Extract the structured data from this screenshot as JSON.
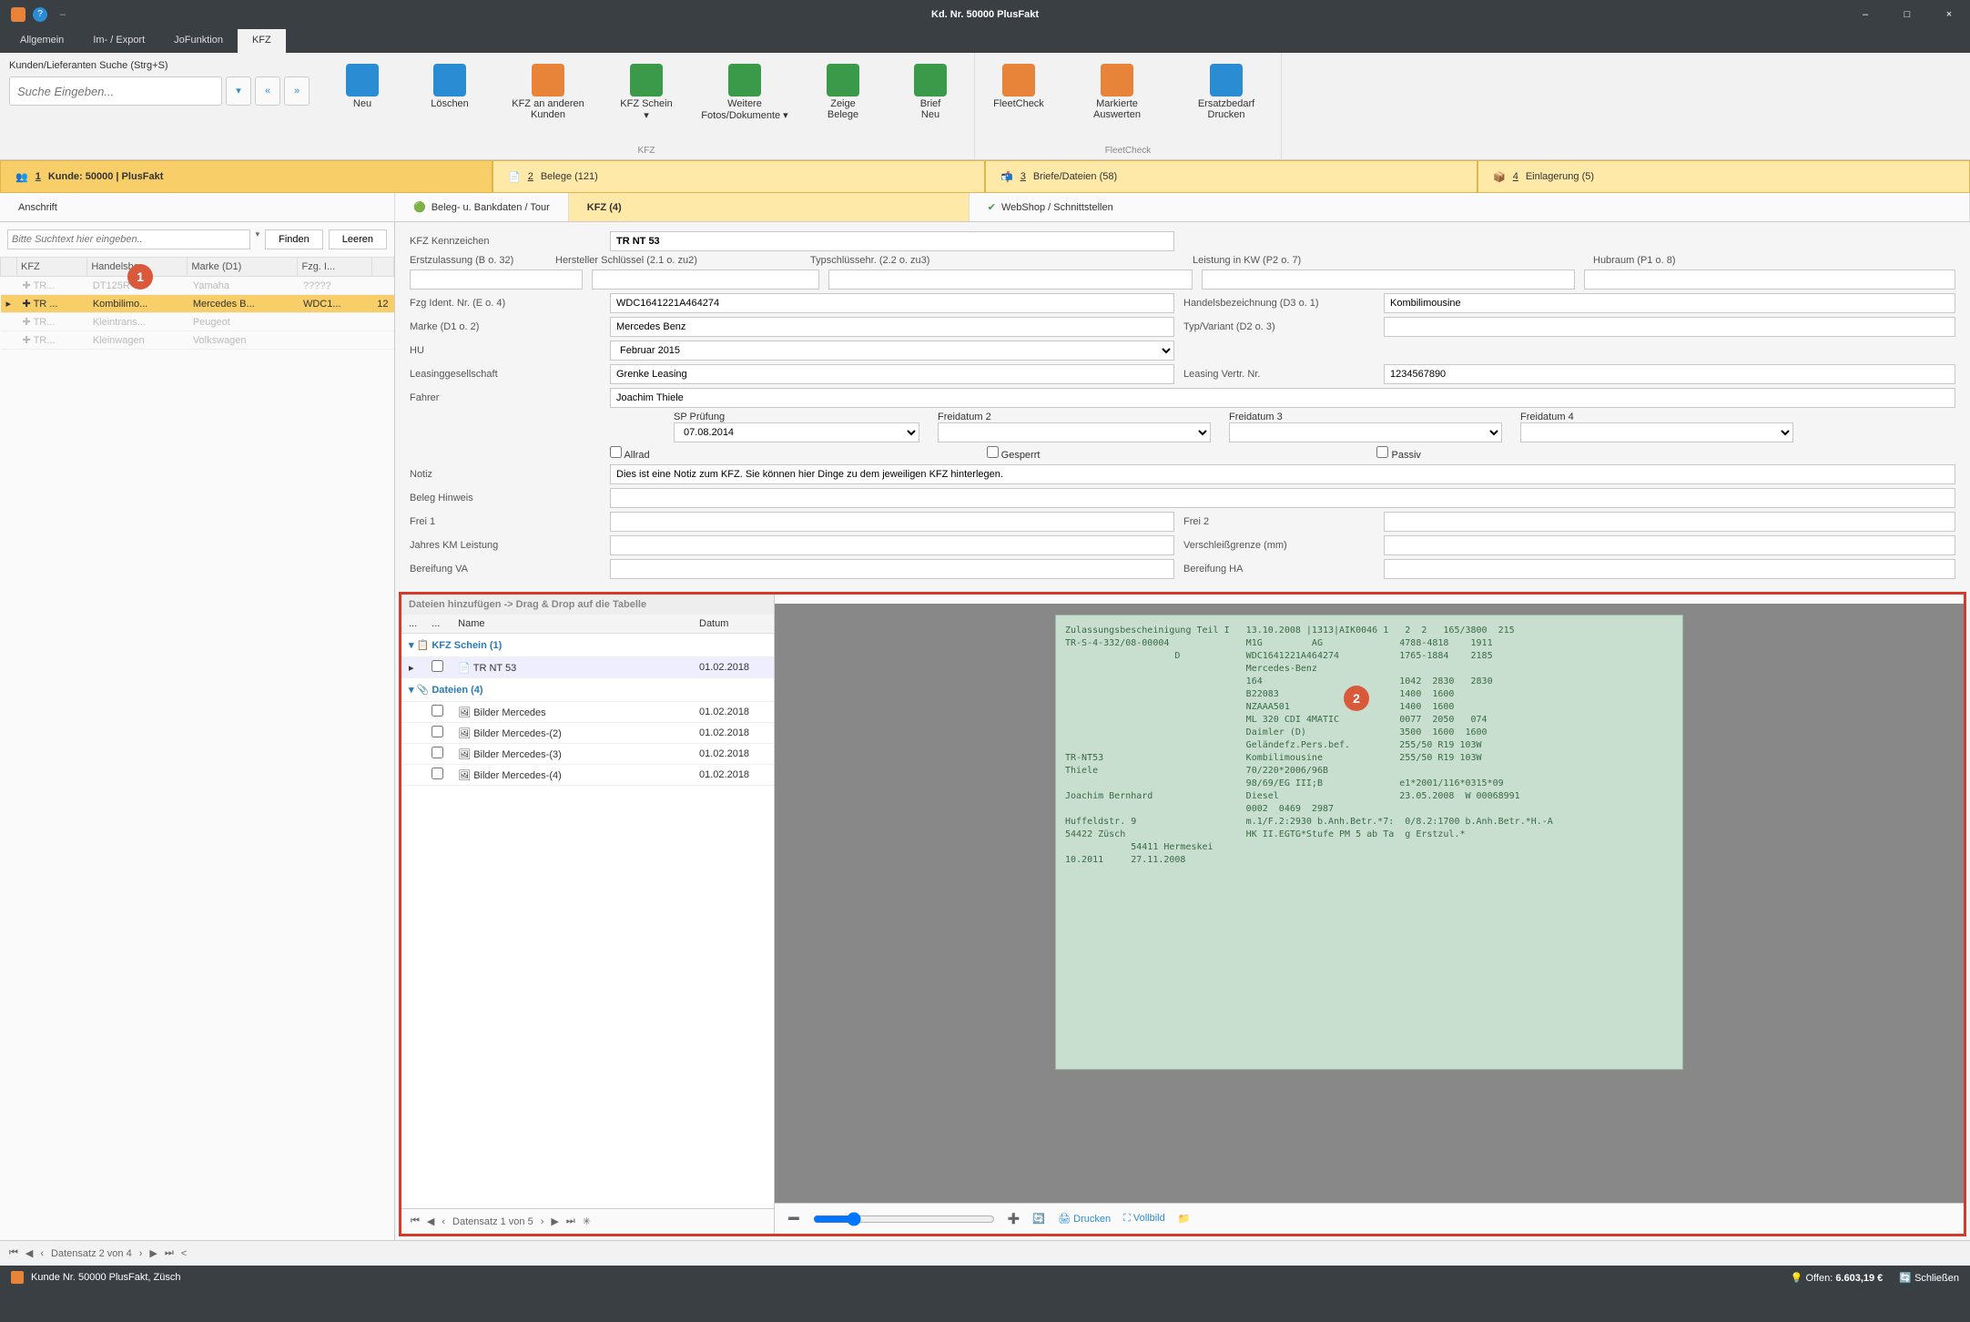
{
  "window": {
    "title": "Kd. Nr. 50000 PlusFakt",
    "minimize": "–",
    "maximize": "□",
    "close": "×",
    "dash": "‒"
  },
  "menu": {
    "items": [
      "Allgemein",
      "Im- / Export",
      "JoFunktion",
      "KFZ"
    ],
    "active_index": 3
  },
  "search_panel": {
    "label": "Kunden/Lieferanten Suche (Strg+S)",
    "placeholder": "Suche Eingeben...",
    "icons": [
      "⌕",
      "«",
      "»"
    ]
  },
  "ribbon": {
    "groups": [
      {
        "label": "KFZ",
        "tools": [
          {
            "name": "neu",
            "label": "Neu",
            "color": "#2a8dd4"
          },
          {
            "name": "loeschen",
            "label": "Löschen",
            "color": "#2a8dd4"
          },
          {
            "name": "kfz-andere",
            "label": "KFZ an anderen\nKunden",
            "color": "#e8833a"
          },
          {
            "name": "kfz-schein",
            "label": "KFZ Schein\n▾",
            "color": "#3a9a4a"
          },
          {
            "name": "weitere-fotos",
            "label": "Weitere\nFotos/Dokumente ▾",
            "color": "#3a9a4a"
          },
          {
            "name": "zeige-belege",
            "label": "Zeige\nBelege",
            "color": "#3a9a4a"
          },
          {
            "name": "brief-neu",
            "label": "Brief\nNeu",
            "color": "#3a9a4a"
          }
        ]
      },
      {
        "label": "FleetCheck",
        "tools": [
          {
            "name": "fleetcheck",
            "label": "FleetCheck",
            "color": "#e8833a"
          },
          {
            "name": "markierte",
            "label": "Markierte\nAuswerten",
            "color": "#e8833a"
          },
          {
            "name": "ersatzbedarf",
            "label": "Ersatzbedarf\nDrucken",
            "color": "#2a8dd4"
          }
        ]
      }
    ]
  },
  "section_tabs": [
    {
      "icon": "👥",
      "key": "1",
      "label": "Kunde: 50000 | PlusFakt"
    },
    {
      "icon": "📄",
      "key": "2",
      "label": "Belege (121)"
    },
    {
      "icon": "📬",
      "key": "3",
      "label": "Briefe/Dateien (58)"
    },
    {
      "icon": "📦",
      "key": "4",
      "label": "Einlagerung (5)"
    }
  ],
  "sub_tabs": [
    {
      "label": "Anschrift",
      "active": false
    },
    {
      "label": "Beleg- u. Bankdaten / Tour",
      "icon": "🟢",
      "active": false
    },
    {
      "label": "KFZ (4)",
      "active": true
    },
    {
      "label": "WebShop / Schnittstellen",
      "icon": "✔",
      "active": false
    }
  ],
  "left_grid": {
    "filter_placeholder": "Bitte Suchtext hier eingeben..",
    "btn_find": "Finden",
    "btn_clear": "Leeren",
    "columns": [
      "KFZ",
      "Handelsbe...",
      "Marke (D1)",
      "Fzg. I..."
    ],
    "rows": [
      {
        "kfz": "TR...",
        "hb": "DT125R",
        "m": "Yamaha",
        "fi": "?????",
        "sel": false
      },
      {
        "kfz": "TR ...",
        "hb": "Kombilimo...",
        "m": "Mercedes B...",
        "fi": "WDC1...",
        "sel": true,
        "extra": "12"
      },
      {
        "kfz": "TR...",
        "hb": "Kleintrans...",
        "m": "Peugeot",
        "fi": "",
        "sel": false
      },
      {
        "kfz": "TR...",
        "hb": "Kleinwagen",
        "m": "Volkswagen",
        "fi": "",
        "sel": false
      }
    ]
  },
  "form": {
    "kennz_lbl": "KFZ Kennzeichen",
    "kennz": "TR NT 53",
    "erstzul_lbl": "Erstzulassung (B o. 32)",
    "herst_lbl": "Hersteller Schlüssel (2.1 o. zu2)",
    "typs_lbl": "Typschlüssehr. (2.2 o. zu3)",
    "kw_lbl": "Leistung in KW (P2 o. 7)",
    "hub_lbl": "Hubraum (P1 o. 8)",
    "fzgid_lbl": "Fzg Ident. Nr. (E o. 4)",
    "fzgid": "WDC1641221A464274",
    "handel_lbl": "Handelsbezeichnung (D3 o. 1)",
    "handel": "Kombilimousine",
    "marke_lbl": "Marke (D1 o. 2)",
    "marke": "Mercedes Benz",
    "typvar_lbl": "Typ/Variant (D2 o. 3)",
    "hu_lbl": "HU",
    "hu": "Februar 2015",
    "leasg_lbl": "Leasinggesellschaft",
    "leasg": "Grenke Leasing",
    "leasnr_lbl": "Leasing Vertr. Nr.",
    "leasnr": "1234567890",
    "fahrer_lbl": "Fahrer",
    "fahrer": "Joachim Thiele",
    "sp_lbl": "SP Prüfung",
    "sp": "07.08.2014",
    "fd2_lbl": "Freidatum 2",
    "fd3_lbl": "Freidatum 3",
    "fd4_lbl": "Freidatum 4",
    "allrad": "Allrad",
    "gesperrt": "Gesperrt",
    "passiv": "Passiv",
    "notiz_lbl": "Notiz",
    "notiz": "Dies ist eine Notiz zum KFZ. Sie können hier Dinge zu dem jeweiligen KFZ hinterlegen.",
    "beleg_lbl": "Beleg Hinweis",
    "frei1_lbl": "Frei 1",
    "frei2_lbl": "Frei 2",
    "jahreskm_lbl": "Jahres KM Leistung",
    "verschl_lbl": "Verschleißgrenze (mm)",
    "bereifva_lbl": "Bereifung VA",
    "bereifha_lbl": "Bereifung HA"
  },
  "files": {
    "header": "Dateien hinzufügen -> Drag & Drop auf die Tabelle",
    "col_name": "Name",
    "col_date": "Datum",
    "group1": "KFZ Schein (1)",
    "group2": "Dateien (4)",
    "rows": [
      {
        "grp": 1,
        "name": "TR NT 53",
        "date": "01.02.2018",
        "sel": true
      },
      {
        "grp": 2,
        "name": "Bilder Mercedes",
        "date": "01.02.2018"
      },
      {
        "grp": 2,
        "name": "Bilder Mercedes-(2)",
        "date": "01.02.2018"
      },
      {
        "grp": 2,
        "name": "Bilder Mercedes-(3)",
        "date": "01.02.2018"
      },
      {
        "grp": 2,
        "name": "Bilder Mercedes-(4)",
        "date": "01.02.2018"
      }
    ],
    "nav": "Datensatz 1 von 5"
  },
  "preview": {
    "doc_lines": [
      "Zulassungsbescheinigung Teil I   13.10.2008 |1313|AIK0046 1   2  2   165/3800  215",
      "TR-S-4-332/08-00004              M1G         AG              4788-4818    1911",
      "                    D            WDC1641221A464274           1765-1884    2185",
      "                                 Mercedes-Benz",
      "                                 164                         1042  2830   2830",
      "                                 B22083                      1400  1600",
      "                                 NZAAA501                    1400  1600",
      "                                 ML 320 CDI 4MATIC           0077  2050   074",
      "                                 Daimler (D)                 3500  1600  1600",
      "                                 Geländefz.Pers.bef.         255/50 R19 103W",
      "TR-NT53                          Kombilimousine              255/50 R19 103W",
      "Thiele                           70/220*2006/96B",
      "                                 98/69/EG III;B              e1*2001/116*0315*09",
      "Joachim Bernhard                 Diesel                      23.05.2008  W 00068991",
      "                                 0002  0469  2987",
      "Huffeldstr. 9                    m.1/F.2:2930 b.Anh.Betr.*7:  0/8.2:1700 b.Anh.Betr.*H.-A",
      "54422 Züsch                      HK II.EGTG*Stufe PM 5 ab Ta  g Erstzul.*",
      "            54411 Hermeskei",
      "10.2011     27.11.2008"
    ],
    "btn_print": "Drucken",
    "btn_full": "Vollbild"
  },
  "footer": {
    "nav": "Datensatz 2 von 4"
  },
  "status": {
    "left": "Kunde Nr. 50000 PlusFakt, Züsch",
    "offen_lbl": "Offen:",
    "offen_val": "6.603,19 €",
    "close": "Schließen"
  }
}
